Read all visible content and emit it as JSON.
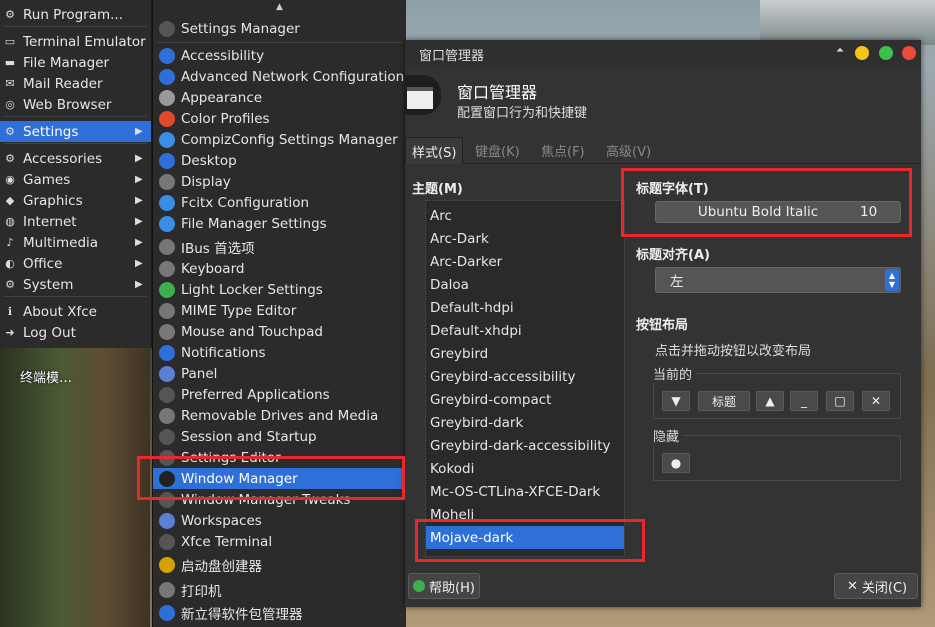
{
  "desktop": {
    "label": "终端模…"
  },
  "main_menu": {
    "items": [
      {
        "label": "Run Program...",
        "icon": "gear-icon",
        "arrow": false
      },
      {
        "label": "Terminal Emulator",
        "icon": "terminal-icon",
        "arrow": false
      },
      {
        "label": "File Manager",
        "icon": "folder-icon",
        "arrow": false
      },
      {
        "label": "Mail Reader",
        "icon": "mail-icon",
        "arrow": false
      },
      {
        "label": "Web Browser",
        "icon": "globe-icon",
        "arrow": false
      },
      {
        "label": "Settings",
        "icon": "settings-icon",
        "arrow": true,
        "selected": true
      },
      {
        "label": "Accessories",
        "icon": "accessories-icon",
        "arrow": true
      },
      {
        "label": "Games",
        "icon": "gamepad-icon",
        "arrow": true
      },
      {
        "label": "Graphics",
        "icon": "graphics-icon",
        "arrow": true
      },
      {
        "label": "Internet",
        "icon": "internet-icon",
        "arrow": true
      },
      {
        "label": "Multimedia",
        "icon": "music-icon",
        "arrow": true
      },
      {
        "label": "Office",
        "icon": "office-icon",
        "arrow": true
      },
      {
        "label": "System",
        "icon": "system-icon",
        "arrow": true
      },
      {
        "label": "About Xfce",
        "icon": "info-icon",
        "arrow": false
      },
      {
        "label": "Log Out",
        "icon": "logout-icon",
        "arrow": false
      }
    ]
  },
  "settings_menu": {
    "items": [
      {
        "label": "Settings Manager",
        "icon": "settings-manager-icon",
        "color": "#555"
      },
      {
        "label": "Accessibility",
        "icon": "accessibility-icon",
        "color": "#2f6fd8"
      },
      {
        "label": "Advanced Network Configuration",
        "icon": "network-icon",
        "color": "#2f6fd8"
      },
      {
        "label": "Appearance",
        "icon": "brush-icon",
        "color": "#999"
      },
      {
        "label": "Color Profiles",
        "icon": "color-icon",
        "color": "#e04a2a"
      },
      {
        "label": "CompizConfig Settings Manager",
        "icon": "compiz-icon",
        "color": "#3a8ee6"
      },
      {
        "label": "Desktop",
        "icon": "desktop-icon",
        "color": "#2f6fd8"
      },
      {
        "label": "Display",
        "icon": "display-icon",
        "color": "#777"
      },
      {
        "label": "Fcitx Configuration",
        "icon": "fcitx-icon",
        "color": "#3a8ee6"
      },
      {
        "label": "File Manager Settings",
        "icon": "file-manager-icon",
        "color": "#3a8ee6"
      },
      {
        "label": "IBus 首选项",
        "icon": "ibus-icon",
        "color": "#777"
      },
      {
        "label": "Keyboard",
        "icon": "keyboard-icon",
        "color": "#777"
      },
      {
        "label": "Light Locker Settings",
        "icon": "lock-icon",
        "color": "#3fae4f"
      },
      {
        "label": "MIME Type Editor",
        "icon": "mime-icon",
        "color": "#777"
      },
      {
        "label": "Mouse and Touchpad",
        "icon": "mouse-icon",
        "color": "#777"
      },
      {
        "label": "Notifications",
        "icon": "notification-icon",
        "color": "#2f6fd8"
      },
      {
        "label": "Panel",
        "icon": "panel-icon",
        "color": "#5c7fd1"
      },
      {
        "label": "Preferred Applications",
        "icon": "preferred-apps-icon",
        "color": "#555"
      },
      {
        "label": "Removable Drives and Media",
        "icon": "drive-icon",
        "color": "#777"
      },
      {
        "label": "Session and Startup",
        "icon": "session-icon",
        "color": "#555"
      },
      {
        "label": "Settings Editor",
        "icon": "settings-editor-icon",
        "color": "#555"
      },
      {
        "label": "Window Manager",
        "icon": "window-manager-icon",
        "color": "#222",
        "selected": true
      },
      {
        "label": "Window Manager Tweaks",
        "icon": "tweaks-icon",
        "color": "#555"
      },
      {
        "label": "Workspaces",
        "icon": "workspaces-icon",
        "color": "#5c7fd1"
      },
      {
        "label": "Xfce Terminal",
        "icon": "terminal-icon",
        "color": "#555"
      },
      {
        "label": "启动盘创建器",
        "icon": "usb-creator-icon",
        "color": "#d6a200"
      },
      {
        "label": "打印机",
        "icon": "printer-icon",
        "color": "#777"
      },
      {
        "label": "新立得软件包管理器",
        "icon": "synaptic-icon",
        "color": "#2f6fd8"
      }
    ]
  },
  "window": {
    "title": "窗口管理器",
    "header_title": "窗口管理器",
    "header_subtitle": "配置窗口行为和快捷键",
    "tabs": [
      {
        "label": "样式(S)",
        "active": true
      },
      {
        "label": "键盘(K)",
        "active": false
      },
      {
        "label": "焦点(F)",
        "active": false
      },
      {
        "label": "高级(V)",
        "active": false
      }
    ],
    "theme_label": "主题(M)",
    "themes": [
      "Arc",
      "Arc-Dark",
      "Arc-Darker",
      "Daloa",
      "Default-hdpi",
      "Default-xhdpi",
      "Greybird",
      "Greybird-accessibility",
      "Greybird-compact",
      "Greybird-dark",
      "Greybird-dark-accessibility",
      "Kokodi",
      "Mc-OS-CTLina-XFCE-Dark",
      "Moheli",
      "Mojave-dark"
    ],
    "selected_theme": "Mojave-dark",
    "title_font_label": "标题字体(T)",
    "title_font_name": "Ubuntu Bold Italic",
    "title_font_size": "10",
    "title_align_label": "标题对齐(A)",
    "title_align_value": "左",
    "button_layout_label": "按钮布局",
    "button_layout_hint": "点击并拖动按钮以改变布局",
    "current_label": "当前的",
    "current_buttons": [
      "▼",
      "标题",
      "▲",
      "_",
      "□",
      "✕"
    ],
    "hidden_label": "隐藏",
    "help_button": "帮助(H)",
    "close_button": "关闭(C)"
  },
  "colors": {
    "accent": "#2f6fd8",
    "highlight_box": "#e8282b"
  }
}
